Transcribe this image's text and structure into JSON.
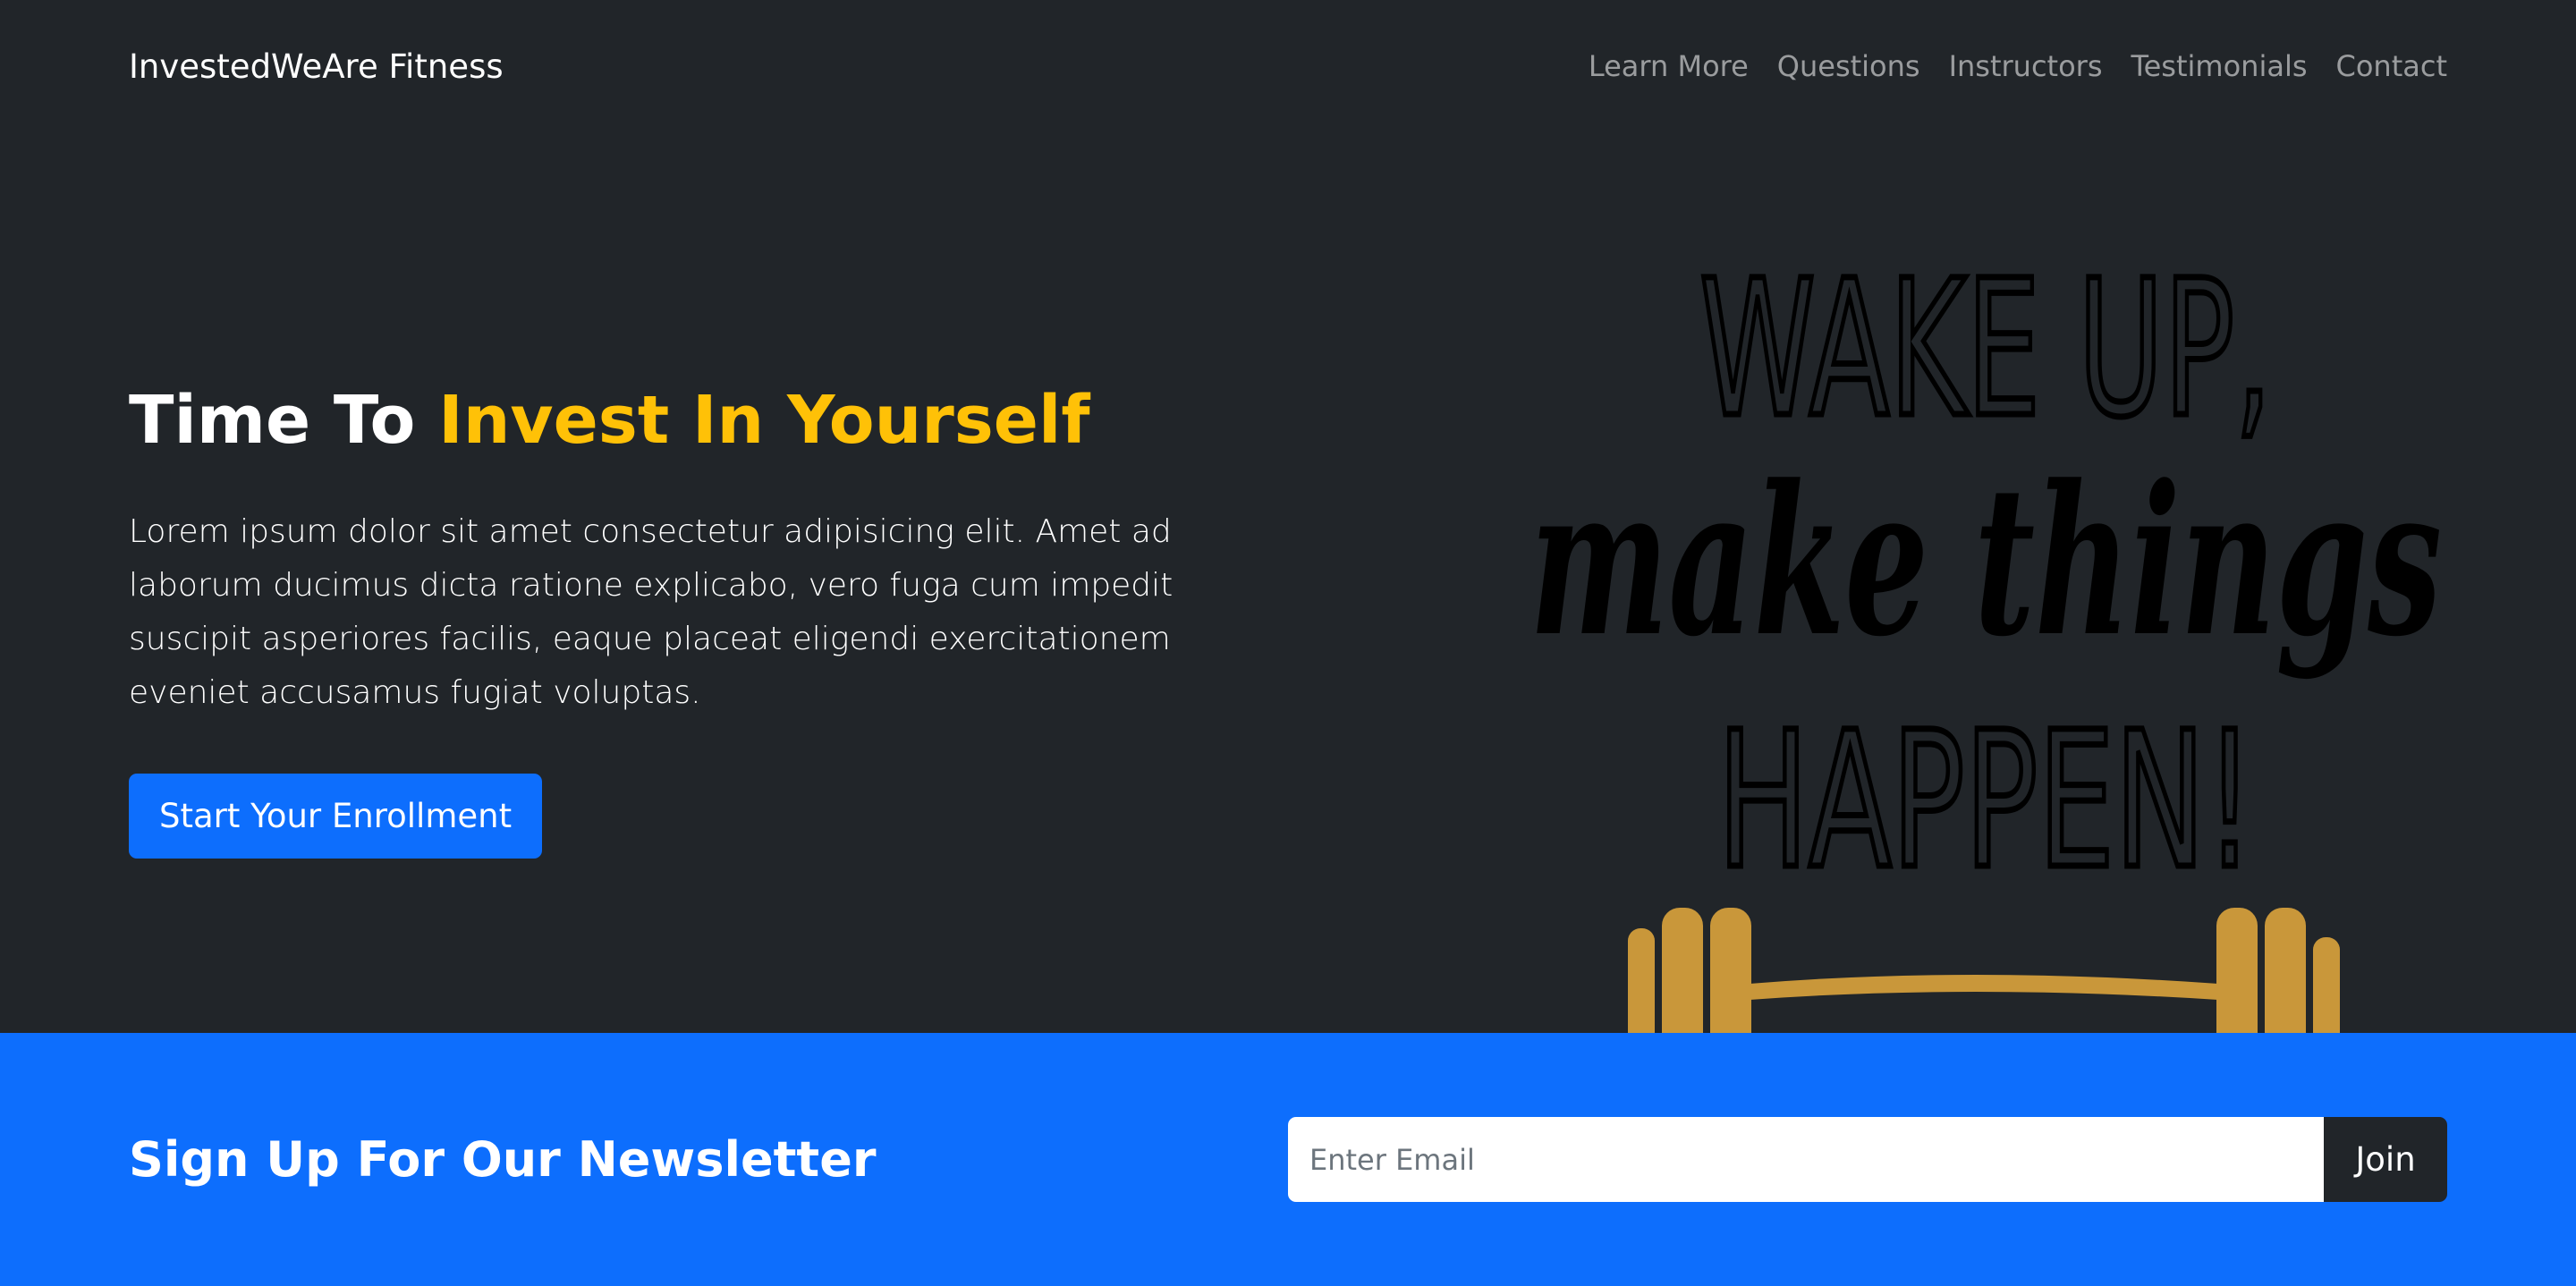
{
  "brand": {
    "name": "InvestedWeAre Fitness"
  },
  "nav": {
    "items": [
      {
        "label": "Learn More"
      },
      {
        "label": "Questions"
      },
      {
        "label": "Instructors"
      },
      {
        "label": "Testimonials"
      },
      {
        "label": "Contact"
      }
    ]
  },
  "hero": {
    "title_prefix": "Time To",
    "title_accent": "Invest In Yourself",
    "lead": "Lorem ipsum dolor sit amet consectetur adipisicing elit. Amet ad laborum ducimus dicta ratione explicabo, vero fuga cum impedit suscipit asperiores facilis, eaque placeat eligendi exercitationem eveniet accusamus fugiat voluptas.",
    "cta_label": "Start Your Enrollment",
    "art": {
      "line1": "WAKE UP,",
      "line2": "make things",
      "line3": "HAPPEN!",
      "icon": "barbell-icon"
    }
  },
  "newsletter": {
    "title": "Sign Up For Our Newsletter",
    "email_placeholder": "Enter Email",
    "join_label": "Join"
  },
  "colors": {
    "background_dark": "#212529",
    "accent_yellow": "#ffc107",
    "primary_blue": "#0d6efd",
    "barbell_gold": "#c9973a"
  }
}
